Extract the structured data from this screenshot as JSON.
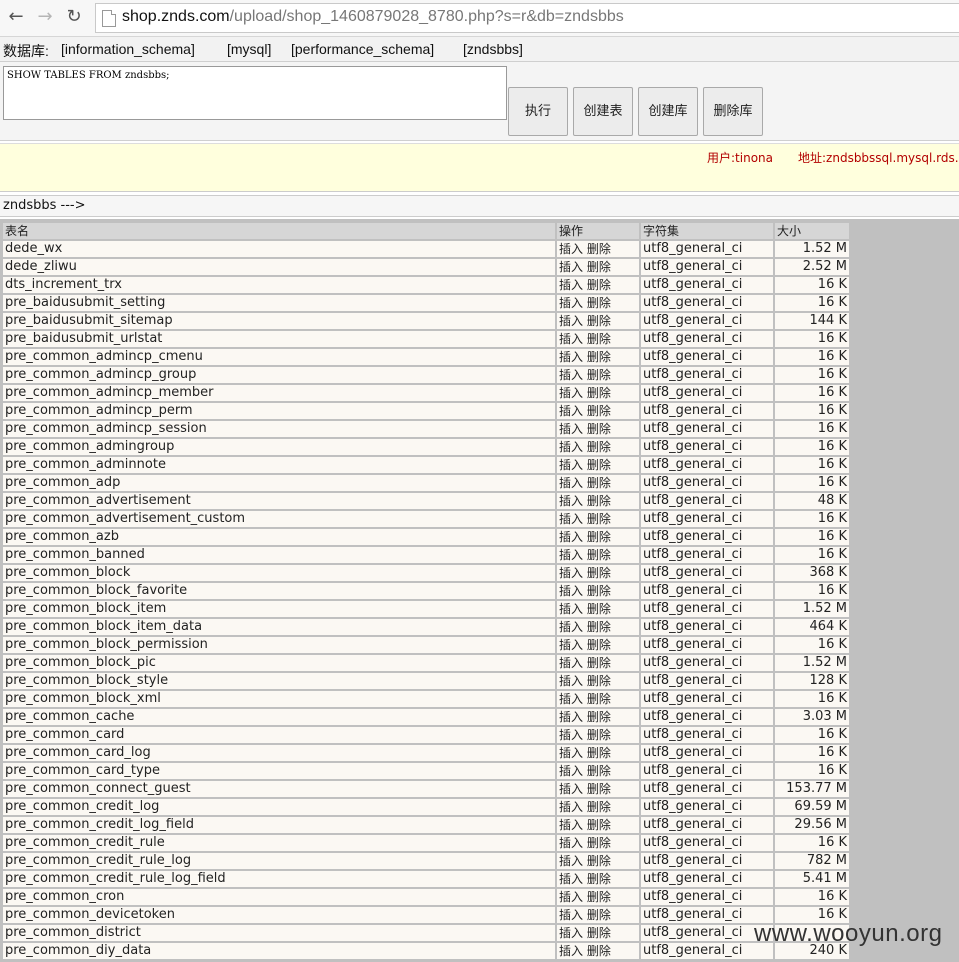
{
  "browser": {
    "url_host": "shop.znds.com",
    "url_path": "/upload/shop_1460879028_8780.php?s=r&db=zndsbbs"
  },
  "db_bar": {
    "label": "数据库:",
    "databases": [
      "[information_schema]",
      "[mysql]",
      "[performance_schema]",
      "[zndsbbs]"
    ]
  },
  "sql_form": {
    "query": "SHOW TABLES FROM zndsbbs;",
    "buttons": [
      "执行",
      "创建表",
      "创建库",
      "删除库"
    ]
  },
  "info_bar": {
    "user": "用户:tinona",
    "address": "地址:zndsbbssql.mysql.rds.a"
  },
  "path": "zndsbbs --->",
  "table": {
    "headers": [
      "表名",
      "操作",
      "字符集",
      "大小"
    ],
    "op_insert": "插入",
    "op_delete": "删除",
    "rows": [
      [
        "dede_wx",
        "utf8_general_ci",
        "1.52 M"
      ],
      [
        "dede_zliwu",
        "utf8_general_ci",
        "2.52 M"
      ],
      [
        "dts_increment_trx",
        "utf8_general_ci",
        "16 K"
      ],
      [
        "pre_baidusubmit_setting",
        "utf8_general_ci",
        "16 K"
      ],
      [
        "pre_baidusubmit_sitemap",
        "utf8_general_ci",
        "144 K"
      ],
      [
        "pre_baidusubmit_urlstat",
        "utf8_general_ci",
        "16 K"
      ],
      [
        "pre_common_admincp_cmenu",
        "utf8_general_ci",
        "16 K"
      ],
      [
        "pre_common_admincp_group",
        "utf8_general_ci",
        "16 K"
      ],
      [
        "pre_common_admincp_member",
        "utf8_general_ci",
        "16 K"
      ],
      [
        "pre_common_admincp_perm",
        "utf8_general_ci",
        "16 K"
      ],
      [
        "pre_common_admincp_session",
        "utf8_general_ci",
        "16 K"
      ],
      [
        "pre_common_admingroup",
        "utf8_general_ci",
        "16 K"
      ],
      [
        "pre_common_adminnote",
        "utf8_general_ci",
        "16 K"
      ],
      [
        "pre_common_adp",
        "utf8_general_ci",
        "16 K"
      ],
      [
        "pre_common_advertisement",
        "utf8_general_ci",
        "48 K"
      ],
      [
        "pre_common_advertisement_custom",
        "utf8_general_ci",
        "16 K"
      ],
      [
        "pre_common_azb",
        "utf8_general_ci",
        "16 K"
      ],
      [
        "pre_common_banned",
        "utf8_general_ci",
        "16 K"
      ],
      [
        "pre_common_block",
        "utf8_general_ci",
        "368 K"
      ],
      [
        "pre_common_block_favorite",
        "utf8_general_ci",
        "16 K"
      ],
      [
        "pre_common_block_item",
        "utf8_general_ci",
        "1.52 M"
      ],
      [
        "pre_common_block_item_data",
        "utf8_general_ci",
        "464 K"
      ],
      [
        "pre_common_block_permission",
        "utf8_general_ci",
        "16 K"
      ],
      [
        "pre_common_block_pic",
        "utf8_general_ci",
        "1.52 M"
      ],
      [
        "pre_common_block_style",
        "utf8_general_ci",
        "128 K"
      ],
      [
        "pre_common_block_xml",
        "utf8_general_ci",
        "16 K"
      ],
      [
        "pre_common_cache",
        "utf8_general_ci",
        "3.03 M"
      ],
      [
        "pre_common_card",
        "utf8_general_ci",
        "16 K"
      ],
      [
        "pre_common_card_log",
        "utf8_general_ci",
        "16 K"
      ],
      [
        "pre_common_card_type",
        "utf8_general_ci",
        "16 K"
      ],
      [
        "pre_common_connect_guest",
        "utf8_general_ci",
        "153.77 M"
      ],
      [
        "pre_common_credit_log",
        "utf8_general_ci",
        "69.59 M"
      ],
      [
        "pre_common_credit_log_field",
        "utf8_general_ci",
        "29.56 M"
      ],
      [
        "pre_common_credit_rule",
        "utf8_general_ci",
        "16 K"
      ],
      [
        "pre_common_credit_rule_log",
        "utf8_general_ci",
        "782 M"
      ],
      [
        "pre_common_credit_rule_log_field",
        "utf8_general_ci",
        "5.41 M"
      ],
      [
        "pre_common_cron",
        "utf8_general_ci",
        "16 K"
      ],
      [
        "pre_common_devicetoken",
        "utf8_general_ci",
        "16 K"
      ],
      [
        "pre_common_district",
        "utf8_general_ci",
        ""
      ],
      [
        "pre_common_diy_data",
        "utf8_general_ci",
        "240 K"
      ]
    ]
  },
  "watermark": "www.wooyun.org"
}
